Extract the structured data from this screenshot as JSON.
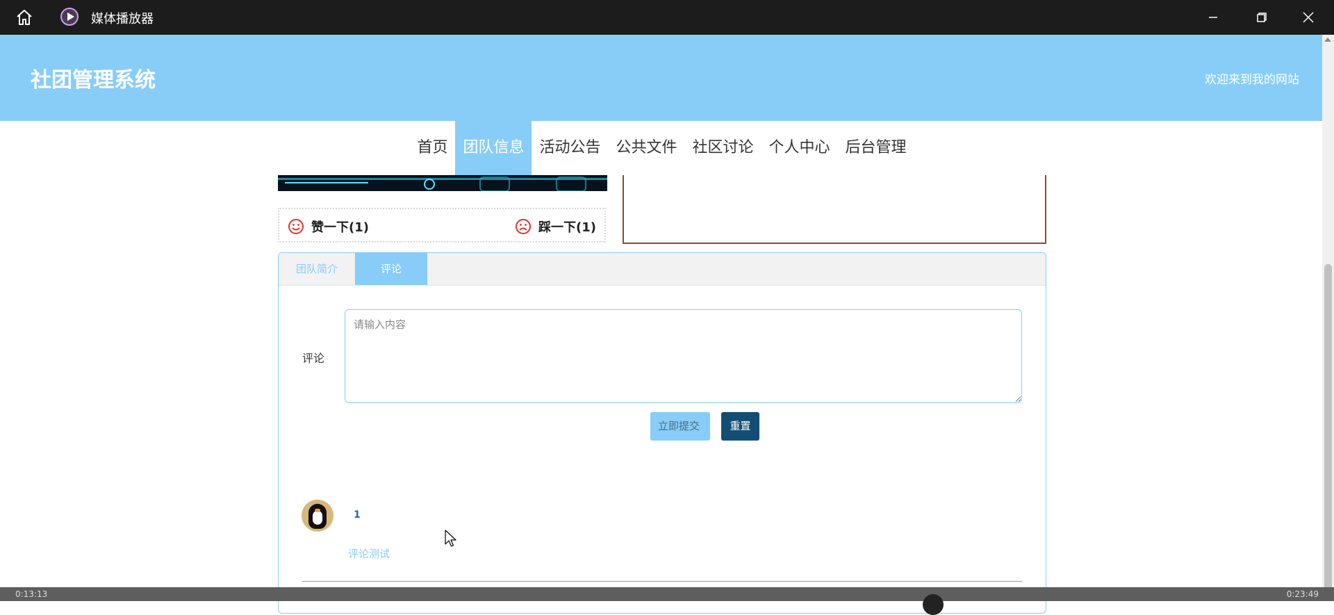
{
  "window": {
    "app_title": "媒体播放器"
  },
  "site": {
    "title": "社团管理系统",
    "welcome": "欢迎来到我的网站"
  },
  "nav": {
    "items": [
      {
        "label": "首页",
        "active": false
      },
      {
        "label": "团队信息",
        "active": true
      },
      {
        "label": "活动公告",
        "active": false
      },
      {
        "label": "公共文件",
        "active": false
      },
      {
        "label": "社区讨论",
        "active": false
      },
      {
        "label": "个人中心",
        "active": false
      },
      {
        "label": "后台管理",
        "active": false
      }
    ]
  },
  "vote": {
    "like_label": "赞一下(1)",
    "dislike_label": "踩一下(1)"
  },
  "tabs": {
    "intro_label": "团队简介",
    "comment_label": "评论",
    "active": "评论"
  },
  "comment_form": {
    "label": "评论",
    "placeholder": "请输入内容",
    "value": "",
    "submit_label": "立即提交",
    "reset_label": "重置"
  },
  "comments": [
    {
      "user": "1",
      "text": "评论测试",
      "avatar": "penguin-avatar"
    }
  ],
  "player": {
    "elapsed": "0:13:13",
    "total": "0:23:49"
  },
  "colors": {
    "accent": "#87cdf8",
    "reset_button": "#134d73",
    "titlebar": "#1c1c1c",
    "border_brown": "#8b4a2a"
  }
}
